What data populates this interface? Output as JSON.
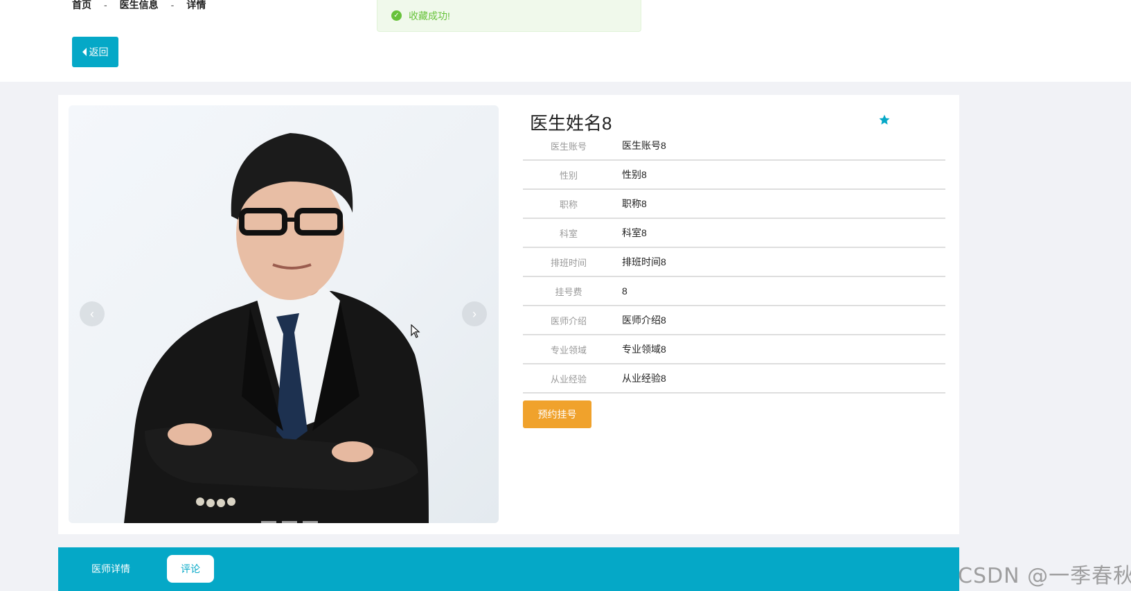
{
  "breadcrumb": {
    "home": "首页",
    "sep1": "-",
    "section": "医生信息",
    "sep2": "-",
    "current": "详情"
  },
  "back_button": {
    "label": "返回"
  },
  "toast": {
    "message": "收藏成功!",
    "icon": "check-circle-icon",
    "color": "#67c23a"
  },
  "doctor": {
    "name": "医生姓名8",
    "favorite_icon": "star-icon",
    "fields": [
      {
        "label": "医生账号",
        "value": "医生账号8"
      },
      {
        "label": "性别",
        "value": "性别8"
      },
      {
        "label": "职称",
        "value": "职称8"
      },
      {
        "label": "科室",
        "value": "科室8"
      },
      {
        "label": "排班时间",
        "value": "排班时间8"
      },
      {
        "label": "挂号费",
        "value": "8"
      },
      {
        "label": "医师介绍",
        "value": "医师介绍8"
      },
      {
        "label": "专业领域",
        "value": "专业领域8"
      },
      {
        "label": "从业经验",
        "value": "从业经验8"
      }
    ]
  },
  "gallery": {
    "prev": "‹",
    "next": "›"
  },
  "book_button": {
    "label": "预约挂号"
  },
  "tabs": [
    {
      "label": "医师详情"
    },
    {
      "label": "评论"
    }
  ],
  "watermark": "CSDN @一季春秋",
  "colors": {
    "accent": "#05a8c7",
    "book": "#f0a22c",
    "success": "#67c23a"
  }
}
